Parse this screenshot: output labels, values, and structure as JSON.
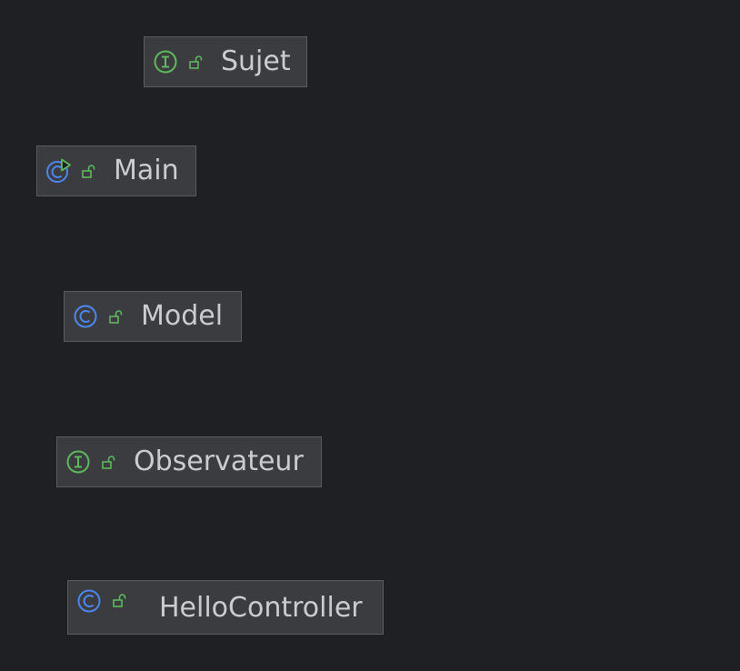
{
  "colors": {
    "background": "#1f2024",
    "node_fill": "#3b3c3f",
    "node_border": "#595b5e",
    "text": "#c9ccd1",
    "interface_icon": "#5fb85f",
    "class_icon": "#4d86f0",
    "run_marker": "#5fb85f",
    "public_lock": "#5fb85f"
  },
  "nodes": [
    {
      "id": "sujet",
      "label": "Sujet",
      "kind": "interface",
      "icon": "interface-icon",
      "visibility_icon": "unlocked-icon"
    },
    {
      "id": "main",
      "label": "Main",
      "kind": "runnable-class",
      "icon": "runnable-class-icon",
      "visibility_icon": "unlocked-icon"
    },
    {
      "id": "model",
      "label": "Model",
      "kind": "class",
      "icon": "class-icon",
      "visibility_icon": "unlocked-icon"
    },
    {
      "id": "observateur",
      "label": "Observateur",
      "kind": "interface",
      "icon": "interface-icon",
      "visibility_icon": "unlocked-icon"
    },
    {
      "id": "hellocontroller",
      "label": "HelloController",
      "kind": "class",
      "icon": "class-icon",
      "visibility_icon": "unlocked-icon"
    }
  ]
}
